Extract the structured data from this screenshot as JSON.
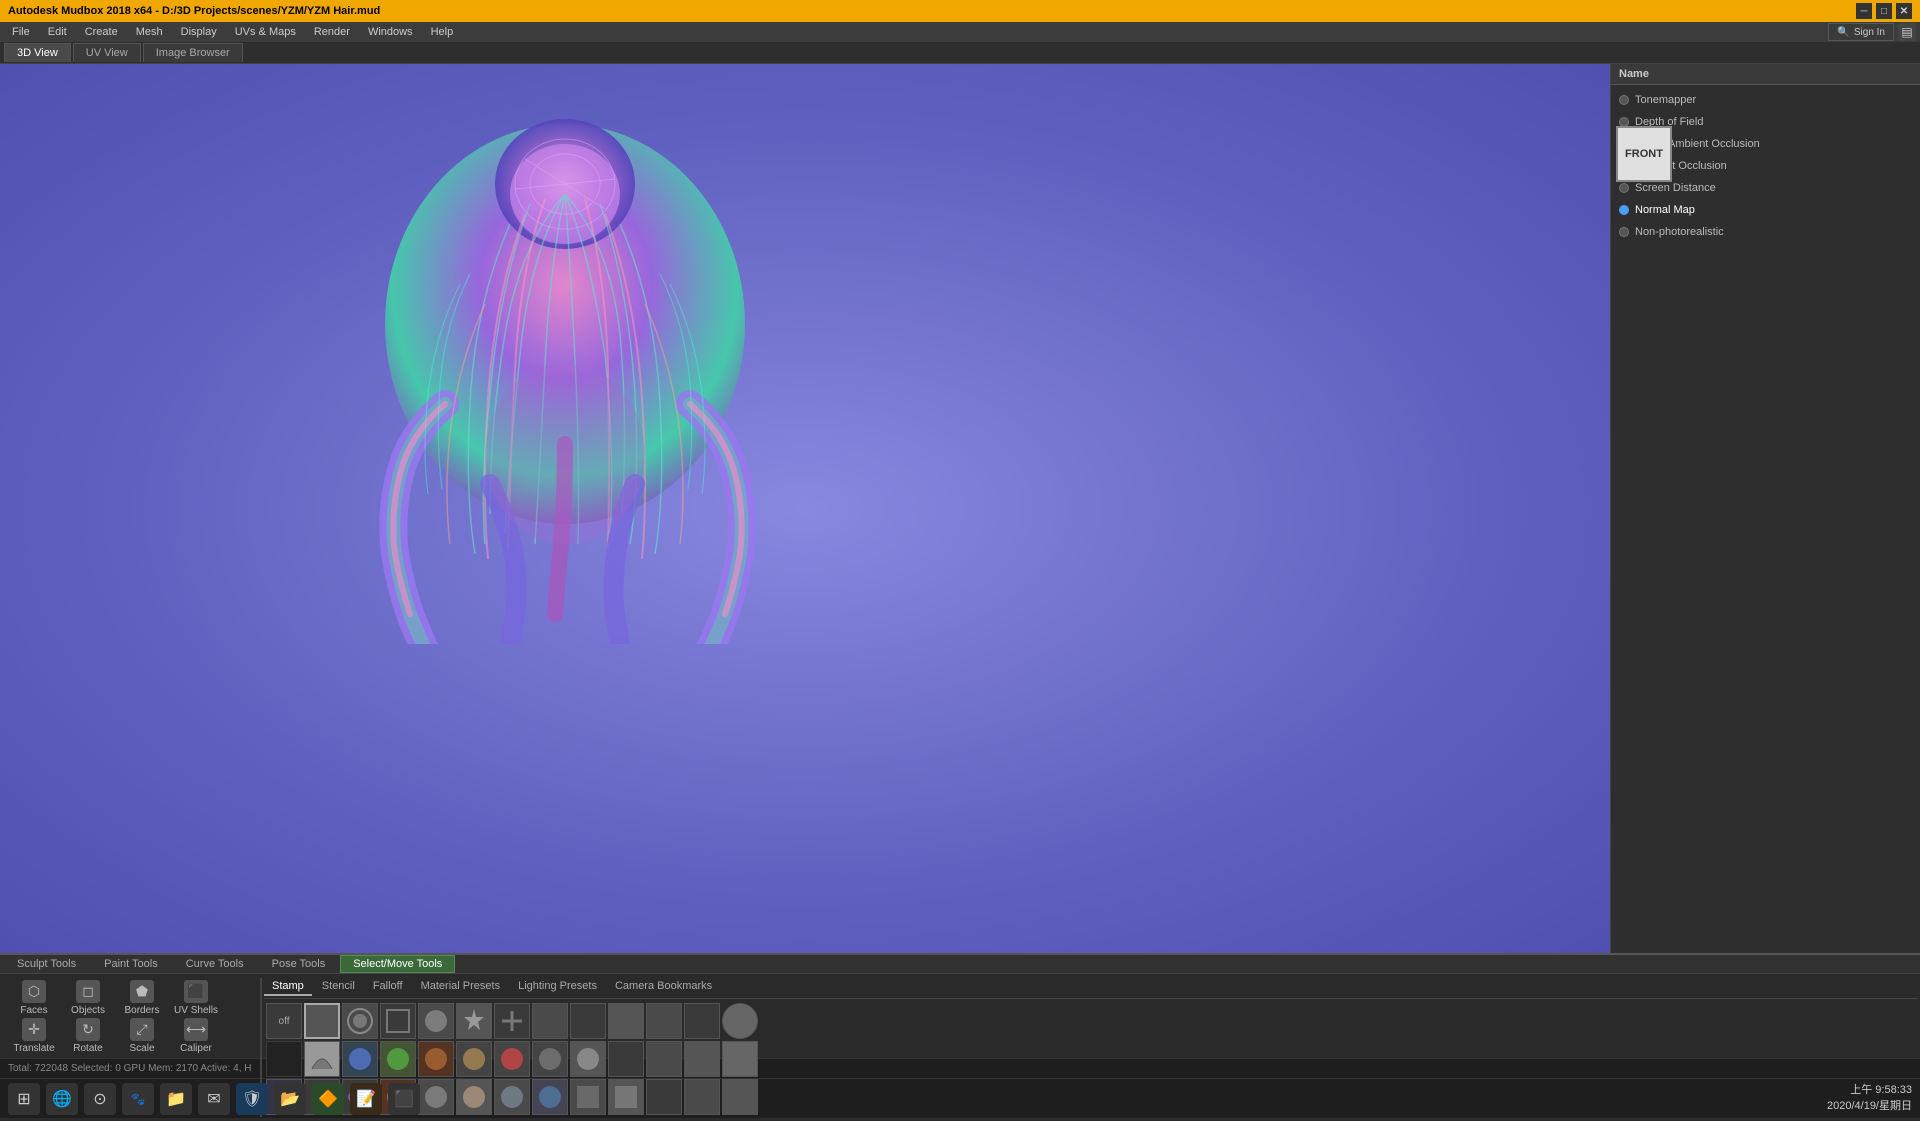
{
  "titleBar": {
    "title": "Autodesk Mudbox 2018 x64 - D:/3D Projects/scenes/YZM/YZM Hair.mud",
    "controls": [
      "─",
      "□",
      "✕"
    ]
  },
  "menuBar": {
    "items": [
      "File",
      "Edit",
      "Create",
      "Mesh",
      "Display",
      "UVs & Maps",
      "Render",
      "Windows",
      "Help"
    ]
  },
  "viewTabs": {
    "tabs": [
      "3D View",
      "UV View",
      "Image Browser"
    ],
    "active": "3D View"
  },
  "signIn": {
    "label": "Sign In",
    "icon": "🔍"
  },
  "rightPanel": {
    "headerLabel": "Name",
    "effects": [
      {
        "name": "Tonemapper",
        "active": false
      },
      {
        "name": "Depth of Field",
        "active": false
      },
      {
        "name": "Cavity Ambient Occlusion",
        "active": false
      },
      {
        "name": "Ambient Occlusion",
        "active": false
      },
      {
        "name": "Screen Distance",
        "active": false
      },
      {
        "name": "Normal Map",
        "active": true
      },
      {
        "name": "Non-photorealistic",
        "active": false
      }
    ],
    "previewLabel": "FRONT"
  },
  "toolTabs": {
    "tabs": [
      "Sculpt Tools",
      "Paint Tools",
      "Curve Tools",
      "Pose Tools",
      "Select/Move Tools"
    ],
    "active": "Select/Move Tools"
  },
  "sculptTools": [
    {
      "name": "Faces",
      "icon": "⬡"
    },
    {
      "name": "Objects",
      "icon": "◻"
    },
    {
      "name": "Borders",
      "icon": "⬟"
    },
    {
      "name": "UV Shells",
      "icon": "⬛"
    },
    {
      "name": "Translate",
      "icon": "✛"
    },
    {
      "name": "Rotate",
      "icon": "↻"
    },
    {
      "name": "Scale",
      "icon": "⤢"
    },
    {
      "name": "Caliper",
      "icon": "⟷"
    }
  ],
  "stampPanel": {
    "tabs": [
      "Stamp",
      "Stencil",
      "Falloff",
      "Material Presets",
      "Lighting Presets",
      "Camera Bookmarks"
    ],
    "activeTab": "Stamp",
    "offButton": "off"
  },
  "statusBar": {
    "info": "Total: 722048  Selected: 0  GPU Mem: 2170  Active: 4, H"
  },
  "taskbar": {
    "icons": [
      "⊞",
      "🌐",
      "⊙",
      "🐾",
      "📁",
      "✉",
      "🛡",
      "📂",
      "🔶",
      "📝",
      "⬛"
    ],
    "clock": "上午 9:58:33",
    "date": "2020/4/19/星期日"
  }
}
